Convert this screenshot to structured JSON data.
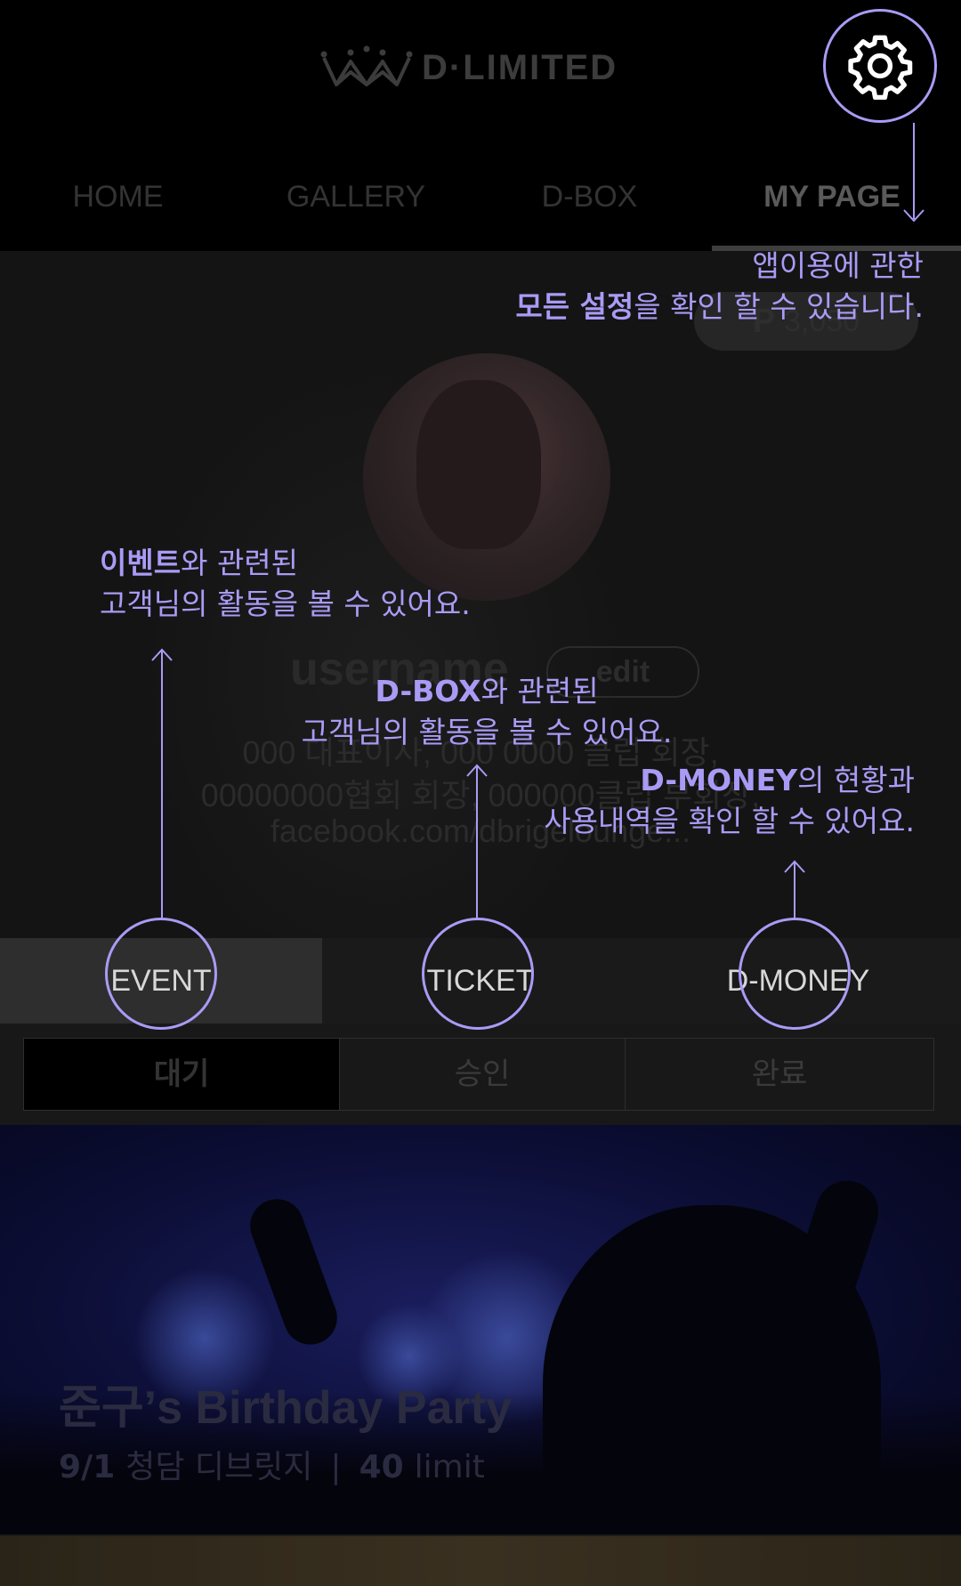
{
  "header": {
    "logo_text": "D·LIMITED",
    "nav": [
      "HOME",
      "GALLERY",
      "D-BOX",
      "MY PAGE"
    ],
    "active_nav": "MY PAGE"
  },
  "profile": {
    "points_symbol": "P",
    "points": "3,050",
    "username": "username",
    "edit_label": "edit",
    "bio": [
      "000 대표이사, 000 0000 클럽 회장,",
      "00000000협회 회장, 000000클럽 부회장,",
      "facebook.com/dbrigelounge..."
    ]
  },
  "tabs": [
    "EVENT",
    "TICKET",
    "D-MONEY"
  ],
  "active_tab": "EVENT",
  "filter": [
    "대기",
    "승인",
    "완료"
  ],
  "active_filter": "대기",
  "event": {
    "title": "준구’s Birthday Party",
    "date": "9/1",
    "venue": "청담 디브릿지",
    "separator": "|",
    "limit_count": "40",
    "limit_label": "limit"
  },
  "annotations": {
    "settings": {
      "line1": "앱이용에 관한",
      "bold": "모든 설정",
      "rest": "을 확인 할 수 있습니다."
    },
    "event": {
      "bold": "이벤트",
      "rest1": "와 관련된",
      "line2": "고객님의 활동을 볼 수 있어요."
    },
    "dbox": {
      "bold": "D-BOX",
      "rest1": "와 관련된",
      "line2": "고객님의 활동을 볼 수 있어요."
    },
    "dmoney": {
      "bold": "D-MONEY",
      "rest1": "의 현황과",
      "line2": "사용내역을 확인 할 수 있어요."
    }
  },
  "colors": {
    "accent": "#a99bf5",
    "background": "#000000"
  },
  "icons": {
    "settings": "gear-icon",
    "logo": "crown-icon"
  }
}
